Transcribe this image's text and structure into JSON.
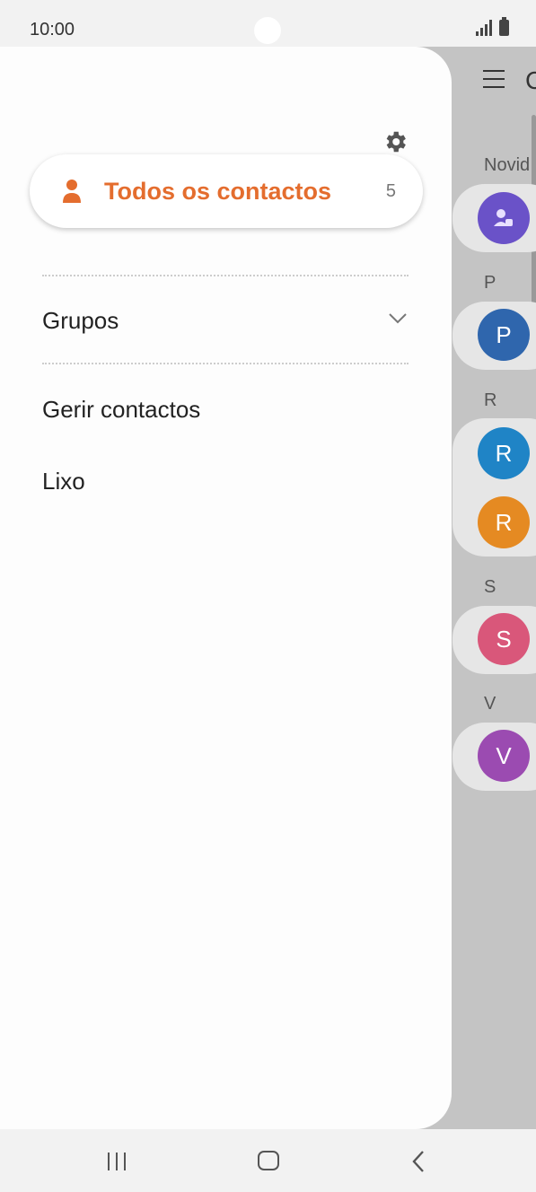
{
  "status_bar": {
    "time": "10:00"
  },
  "background_list": {
    "title_fragment": "C",
    "sections": [
      {
        "label": "Novid",
        "contacts": [
          {
            "initial": "",
            "icon": "group-icon",
            "color": "#6a52c8"
          }
        ]
      },
      {
        "label": "P",
        "contacts": [
          {
            "initial": "P",
            "color": "#2f66ad"
          }
        ]
      },
      {
        "label": "R",
        "contacts": [
          {
            "initial": "R",
            "color": "#1f84c6"
          },
          {
            "initial": "R",
            "color": "#e58a22"
          }
        ]
      },
      {
        "label": "S",
        "contacts": [
          {
            "initial": "S",
            "color": "#d9577a"
          }
        ]
      },
      {
        "label": "V",
        "contacts": [
          {
            "initial": "V",
            "color": "#9b4bb1"
          }
        ]
      }
    ]
  },
  "drawer": {
    "settings_icon": "gear-icon",
    "all_contacts": {
      "label": "Todos os contactos",
      "count": "5",
      "icon": "person-icon",
      "accent": "#e46d2e"
    },
    "groups": {
      "label": "Grupos",
      "icon": "chevron-down-icon"
    },
    "manage": {
      "label": "Gerir contactos"
    },
    "trash": {
      "label": "Lixo"
    }
  },
  "nav_bar": {
    "recents_icon": "recents-icon",
    "home_icon": "home-icon",
    "back_icon": "back-icon"
  }
}
